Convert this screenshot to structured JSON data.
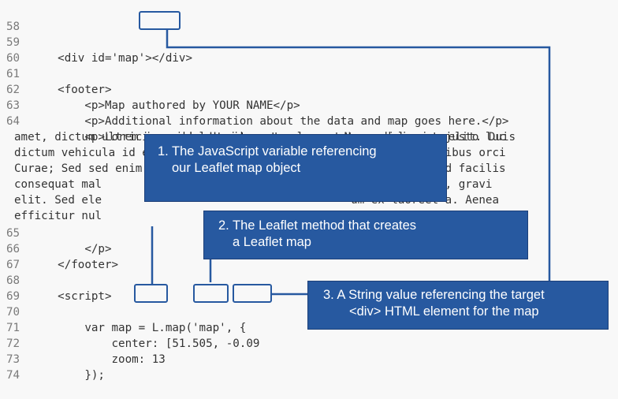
{
  "code": {
    "lines": [
      {
        "num": "58",
        "text": ""
      },
      {
        "num": "59",
        "text": "    <div id='map'></div>"
      },
      {
        "num": "60",
        "text": ""
      },
      {
        "num": "61",
        "text": "    <footer>"
      },
      {
        "num": "62",
        "text": "        <p>Map authored by YOUR NAME</p>"
      },
      {
        "num": "63",
        "text": "        <p>Additional information about the data and map goes here.</p>"
      },
      {
        "num": "64",
        "text": "        <p>Lorem ipsum dolor sit amet, consectetur adipiscing elit. Duis"
      },
      {
        "num": "",
        "text": "amet, dictum ultricies nibh. Ut id auctor lacus. Nam a dolor et justo luc"
      },
      {
        "num": "",
        "text": "dictum vehicula id eu elit. Vestibulum ante ipsum primis in faucibus orci"
      },
      {
        "num": "",
        "text": "Curae; Sed sed enim nisl. Vestibulum commodo imperdiet lacus, sed facilis"
      },
      {
        "num": "",
        "text": "consequat mal                                     convallis nisl, gravi"
      },
      {
        "num": "",
        "text": "elit. Sed ele                                     um ex laoreet a. Aenea"
      },
      {
        "num": "",
        "text": "efficitur nul                                    odales dui vehicula at"
      },
      {
        "num": "65",
        "text": "        </p>"
      },
      {
        "num": "66",
        "text": "    </footer>"
      },
      {
        "num": "67",
        "text": ""
      },
      {
        "num": "68",
        "text": "    <script>"
      },
      {
        "num": "69",
        "text": ""
      },
      {
        "num": "70",
        "text": "        var map = L.map('map', {"
      },
      {
        "num": "71",
        "text": "            center: [51.505, -0.09"
      },
      {
        "num": "72",
        "text": "            zoom: 13"
      },
      {
        "num": "73",
        "text": "        });"
      },
      {
        "num": "74",
        "text": ""
      }
    ]
  },
  "callouts": [
    {
      "lines": [
        "1. The JavaScript variable referencing",
        "our Leaflet map object"
      ]
    },
    {
      "lines": [
        "2. The Leaflet method that creates",
        "a Leaflet map"
      ]
    },
    {
      "lines": [
        "3. A String value referencing the target",
        "<div> HTML element for the map"
      ]
    }
  ],
  "colors": {
    "accent": "#2759a0",
    "background": "#f8f8f8"
  }
}
